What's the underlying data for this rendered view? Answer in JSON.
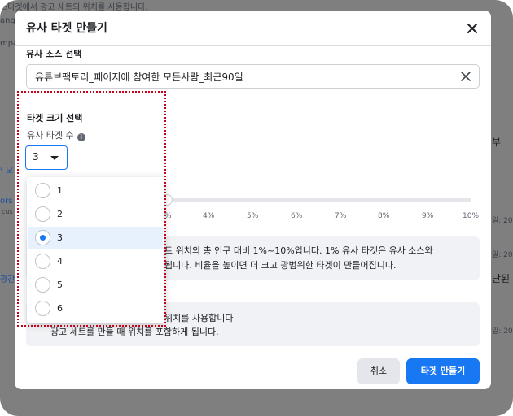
{
  "background": {
    "text_top": "스타겟에서 광고 세트의 위치를 사용합니다.",
    "frag_ange": "ange",
    "frag_mpa": "mpa",
    "frag_mo": "ʸ 모",
    "frag_ors": "ors",
    "frag_cus": "cus",
    "frag_gan": "광간",
    "right_bu": "부",
    "right_il1": "일: 20",
    "right_il2": "일: 20",
    "right_dan": "단된",
    "right_il3": "일: 20"
  },
  "modal": {
    "title": "유사 타겟 만들기",
    "source_label": "유사 소스 선택",
    "source_value": "유튜브팩토리_페이지에 참여한 모든사람_최근90일",
    "size_label": "타겟 크기 선택",
    "count_label": "유사 타겟 수",
    "selected_value": "3",
    "ticks": [
      "%",
      "4%",
      "5%",
      "6%",
      "7%",
      "8%",
      "9%",
      "10%"
    ],
    "info1_line1": "트 위치의 총 인구 대비 1%~10%입니다. 1% 유사 타겟은 유사 소스와",
    "info1_line2": "됩니다. 비율을 높이면 더 크고 광범위한 타겟이 만들어집니다.",
    "info2_line1": "위치를 사용합니다",
    "info2_line2": "광고 세트를 만들 때 위치를 포함하게 됩니다.",
    "cancel_label": "취소",
    "create_label": "타겟 만들기"
  },
  "dropdown": {
    "options": [
      "1",
      "2",
      "3",
      "4",
      "5",
      "6"
    ],
    "selected_index": 2
  },
  "colors": {
    "accent": "#1877f2",
    "highlight_border": "#c4001a"
  },
  "icons": {
    "close": "close-icon",
    "clear": "clear-icon",
    "info": "info-icon",
    "caret": "caret-down-icon"
  }
}
